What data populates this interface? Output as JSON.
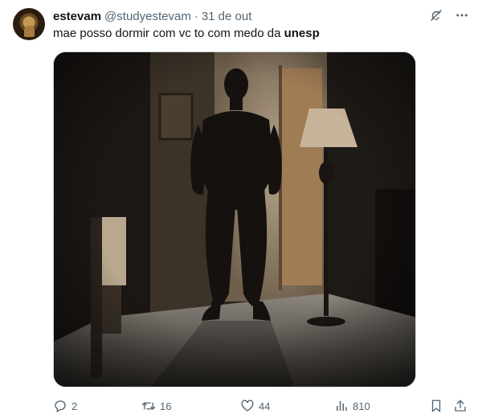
{
  "author": {
    "name": "estevam",
    "handle": "@studyestevam",
    "separator": "·",
    "date": "31 de out"
  },
  "tweet": {
    "text_plain": "mae posso dormir com vc to com medo da ",
    "text_bold": "unesp"
  },
  "actions": {
    "replies": "2",
    "retweets": "16",
    "likes": "44",
    "views": "810"
  },
  "icons": {
    "top": [
      "grok-icon",
      "more-icon"
    ],
    "bottom": [
      "reply-icon",
      "retweet-icon",
      "like-icon",
      "views-icon",
      "bookmark-icon",
      "share-icon"
    ]
  }
}
